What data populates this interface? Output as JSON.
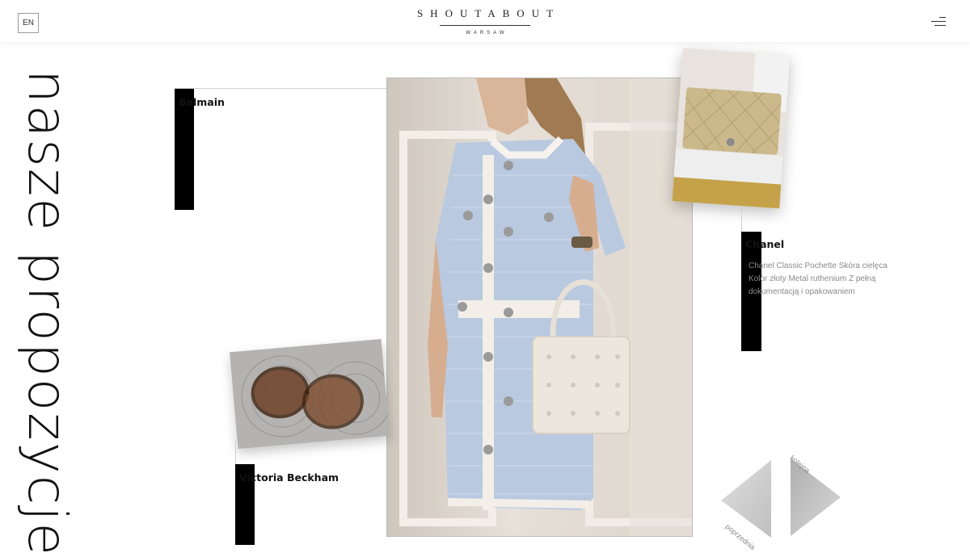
{
  "header": {
    "lang_label": "EN",
    "logo_name": "SHOUTABOUT",
    "logo_city": "WARSAW"
  },
  "page": {
    "vertical_title": "nasze propozycje"
  },
  "products": [
    {
      "brand": "Balmain"
    },
    {
      "brand": "Chanel",
      "description": "Chanel Classic Pochette Skóra cielęca Kolor złoty Metal ruthenium Z pełną dokumentacją i opakowaniem"
    },
    {
      "brand": "Victoria Beckham"
    }
  ],
  "nav": {
    "prev_label": "poprzednia",
    "next_label": "kolejna"
  },
  "colors": {
    "accent_bar": "#000000",
    "text": "#111111",
    "muted": "#8a8a8a"
  }
}
